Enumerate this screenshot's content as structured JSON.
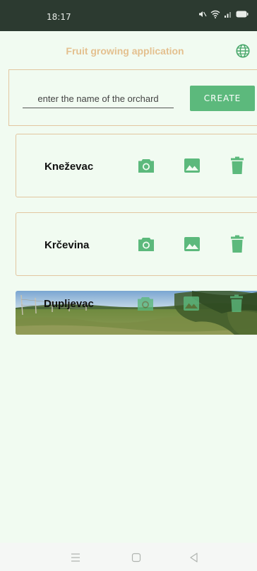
{
  "status_bar": {
    "time": "18:17",
    "icons": [
      "mute-icon",
      "wifi-icon",
      "signal-icon",
      "battery-icon"
    ]
  },
  "header": {
    "title": "Fruit growing application",
    "language_icon": "globe-icon"
  },
  "create_form": {
    "input_placeholder": "enter the name of the orchard",
    "input_value": "",
    "create_label": "CREATE"
  },
  "orchards": [
    {
      "name": "Kneževac",
      "has_photo": false
    },
    {
      "name": "Krčevina",
      "has_photo": false
    },
    {
      "name": "Dupljevac",
      "has_photo": true
    }
  ],
  "card_actions": [
    "camera-icon",
    "gallery-icon",
    "trash-icon"
  ],
  "nav_bar": [
    "menu-icon",
    "home-icon",
    "back-icon"
  ],
  "colors": {
    "accent_green": "#5cb97c",
    "title_tan": "#e4c08f",
    "card_border": "#e2c6a0",
    "background": "#f1fbf1",
    "status_bar": "#2c3a30"
  }
}
